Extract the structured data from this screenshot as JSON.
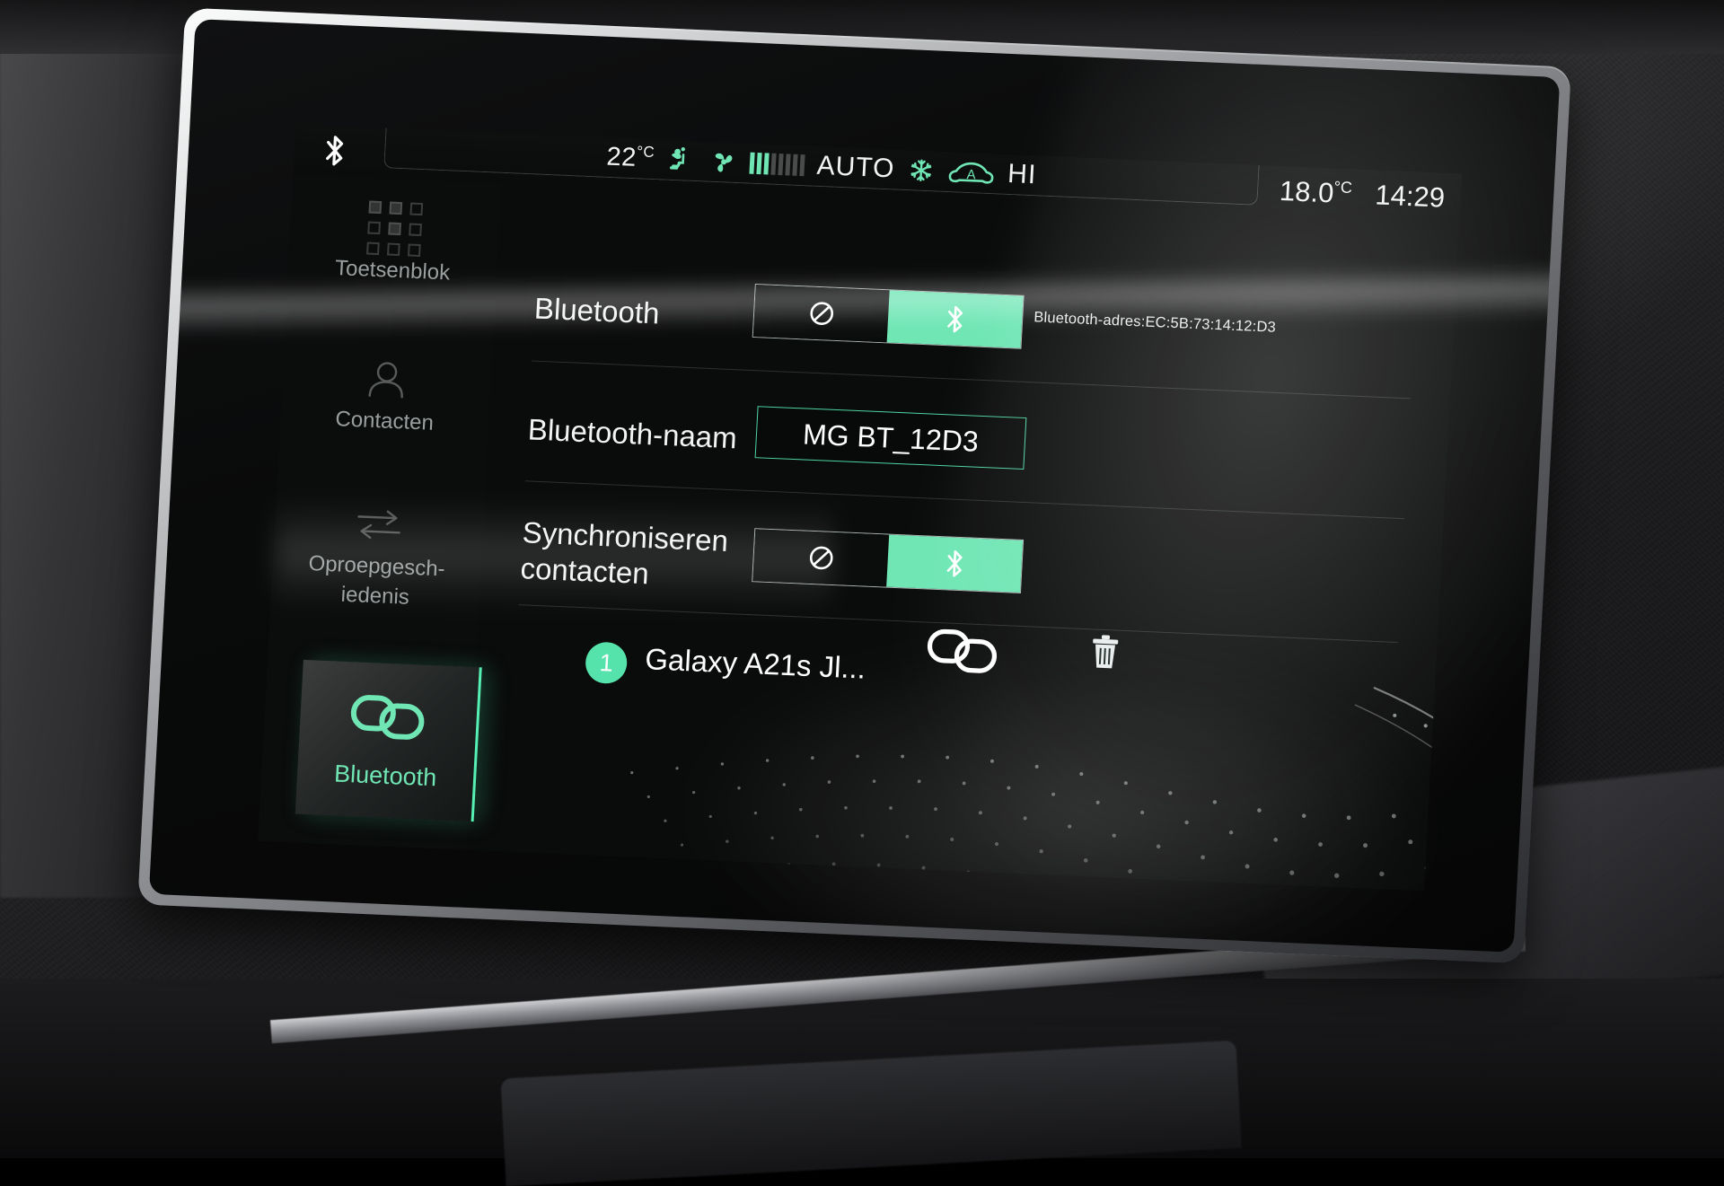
{
  "statusbar": {
    "bt_icon": "bluetooth-icon",
    "cabin_temp": "22",
    "cabin_temp_unit": "°C",
    "airflow_icon": "airflow-body-icon",
    "fan_icon": "fan-icon",
    "fan_level": 3,
    "fan_level_max": 8,
    "auto_label": "AUTO",
    "ac_icon": "snowflake-icon",
    "recirc_icon": "auto-recirculation-car-icon",
    "hi_label": "HI",
    "outside_temp": "18.0",
    "outside_temp_unit": "°C",
    "clock": "14:29"
  },
  "sidebar": {
    "items": [
      {
        "label": "Toetsenblok",
        "icon": "keypad-icon",
        "active": false
      },
      {
        "label": "Contacten",
        "icon": "person-icon",
        "active": false
      },
      {
        "label": "Oproepgesch-\niedenis",
        "label_line1": "Oproepgesch-",
        "label_line2": "iedenis",
        "icon": "call-history-arrows-icon",
        "active": false
      },
      {
        "label": "Bluetooth",
        "icon": "bluetooth-link-icon",
        "active": true
      }
    ]
  },
  "content": {
    "bluetooth_row": {
      "label": "Bluetooth",
      "toggle_off_icon": "prohibited-icon",
      "toggle_on_icon": "bluetooth-icon",
      "state": "on",
      "address_hint": "Bluetooth-adres:EC:5B:73:14:12:D3"
    },
    "name_row": {
      "label": "Bluetooth-naam",
      "value": "MG BT_12D3"
    },
    "sync_row": {
      "label_line1": "Synchroniseren",
      "label_line2": "contacten",
      "toggle_off_icon": "prohibited-icon",
      "toggle_on_icon": "bluetooth-icon",
      "state": "on"
    },
    "device": {
      "badge": "1",
      "name": "Galaxy A21s Jl...",
      "link_icon": "link-connected-icon",
      "delete_icon": "trash-icon"
    }
  },
  "colors": {
    "accent": "#6fe6b4",
    "accent_bright": "#57f0b4",
    "text": "#f2f4f4",
    "screen_bg": "#0a0b0b",
    "bezel": "#d8dadb"
  }
}
